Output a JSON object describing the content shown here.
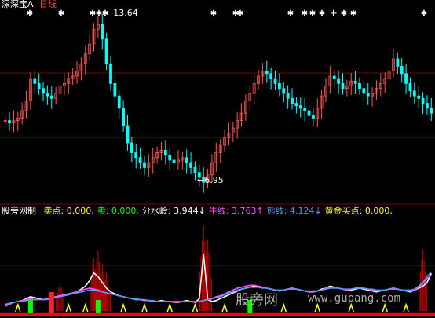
{
  "header": {
    "app_name": "深深宝",
    "symbol": "A",
    "period": "日线"
  },
  "price_panel": {
    "high_label": "13.64",
    "low_label": "6.95",
    "signal_marks": [
      "✱",
      "✱",
      "✱",
      "✱",
      "✱",
      "✱",
      "✱",
      "✱",
      "✱",
      "✱",
      "✱",
      "✱",
      "✚",
      "✱",
      "✱",
      "✱"
    ]
  },
  "indicator_panel": {
    "name": "股旁网制",
    "items": [
      {
        "label": "卖点:",
        "value": "0.000,",
        "color": "#ffff00"
      },
      {
        "label": "卖:",
        "value": "0.000,",
        "color": "#00ff00"
      },
      {
        "label": "分水岭:",
        "value": "3.944",
        "arrow": "↓",
        "color": "#ffffff"
      },
      {
        "label": "牛线:",
        "value": "3.763",
        "arrow": "↑",
        "color": "#ff55ff"
      },
      {
        "label": "熊线:",
        "value": "4.124",
        "arrow": "↓",
        "color": "#5599ff"
      },
      {
        "label": "黄金买点:",
        "value": "0.000,",
        "color": "#ffff00"
      }
    ]
  },
  "watermark": {
    "text": "股旁网",
    "url": "www.gupang.com"
  },
  "colors": {
    "up": "#ff5555",
    "down": "#00ffff",
    "grid": "#7a0000",
    "bar": "#b00000",
    "bull_line": "#ff55ff",
    "bear_line": "#5599ff",
    "divide_line": "#ffffff",
    "buy_mark": "#ffff00",
    "green_bar": "#00ff00"
  },
  "chart_data": [
    {
      "type": "candlestick",
      "title": "深深宝A 日线",
      "ylim": [
        6.5,
        14.0
      ],
      "high_marker": 13.64,
      "low_marker": 6.95,
      "series": [
        {
          "name": "close",
          "values": [
            9.5,
            9.4,
            9.5,
            9.6,
            9.9,
            10.3,
            11.2,
            11.0,
            10.8,
            10.6,
            10.5,
            10.4,
            10.6,
            10.9,
            11.0,
            11.2,
            11.3,
            11.5,
            11.8,
            12.2,
            12.6,
            13.2,
            13.4,
            12.8,
            11.8,
            11.0,
            10.5,
            10.0,
            9.3,
            8.6,
            8.2,
            8.0,
            7.8,
            7.6,
            7.8,
            8.0,
            8.2,
            8.3,
            8.1,
            7.9,
            7.8,
            7.9,
            8.0,
            7.8,
            7.6,
            7.4,
            7.2,
            7.0,
            7.3,
            7.8,
            8.2,
            8.5,
            8.8,
            9.0,
            9.2,
            9.5,
            9.8,
            10.3,
            10.6,
            11.0,
            11.3,
            11.5,
            11.4,
            11.2,
            11.0,
            10.8,
            10.6,
            10.4,
            10.2,
            10.1,
            10.0,
            9.9,
            9.7,
            9.6,
            10.0,
            10.5,
            10.9,
            11.3,
            11.2,
            11.0,
            10.8,
            10.9,
            11.1,
            11.0,
            10.8,
            10.6,
            10.5,
            10.6,
            10.8,
            11.0,
            11.2,
            11.5,
            12.0,
            11.7,
            11.4,
            11.0,
            10.7,
            10.5,
            10.4,
            10.2,
            10.0,
            9.8
          ]
        }
      ]
    },
    {
      "type": "bar",
      "title": "股旁网制",
      "series": [
        {
          "name": "分水岭",
          "values": [
            0.6,
            0.8,
            0.9,
            1.0,
            1.1,
            1.3,
            1.5,
            1.4,
            1.3,
            1.2,
            1.3,
            1.4,
            1.5,
            1.6,
            1.6,
            1.7,
            1.9,
            2.0,
            2.3,
            2.6,
            3.2,
            4.0,
            3.6,
            3.0,
            2.4,
            2.0,
            1.8,
            1.6,
            1.5,
            1.4,
            1.3,
            1.2,
            1.2,
            1.1,
            1.1,
            1.0,
            1.0,
            1.1,
            1.0,
            1.0,
            0.9,
            0.9,
            1.0,
            1.1,
            1.0,
            0.9,
            1.3,
            6.0,
            1.2,
            1.0,
            1.1,
            1.3,
            1.5,
            1.7,
            1.9,
            2.1,
            2.3,
            2.4,
            2.5,
            2.6,
            2.6,
            2.5,
            2.4,
            2.3,
            2.2,
            2.1,
            2.2,
            2.3,
            2.4,
            2.3,
            2.2,
            2.1,
            2.0,
            2.0,
            2.1,
            2.3,
            2.4,
            2.6,
            2.5,
            2.4,
            2.3,
            2.2,
            2.2,
            2.3,
            2.4,
            2.3,
            2.2,
            2.1,
            2.0,
            2.1,
            2.2,
            2.3,
            2.4,
            2.3,
            2.2,
            2.1,
            2.0,
            2.2,
            2.4,
            2.6,
            3.0,
            3.944
          ]
        },
        {
          "name": "牛线",
          "values": [
            0.5,
            0.7,
            0.9,
            1.0,
            1.1,
            1.2,
            1.3,
            1.2,
            1.2,
            1.2,
            1.3,
            1.4,
            1.5,
            1.6,
            1.7,
            1.8,
            1.9,
            2.0,
            2.2,
            2.3,
            2.4,
            2.3,
            2.2,
            2.0,
            1.9,
            1.8,
            1.7,
            1.6,
            1.5,
            1.4,
            1.3,
            1.2,
            1.2,
            1.1,
            1.1,
            1.0,
            1.0,
            1.0,
            1.0,
            1.0,
            0.9,
            0.9,
            1.0,
            1.0,
            1.0,
            0.9,
            1.0,
            1.1,
            1.2,
            1.3,
            1.5,
            1.6,
            1.8,
            2.0,
            2.2,
            2.4,
            2.5,
            2.6,
            2.7,
            2.7,
            2.6,
            2.5,
            2.4,
            2.3,
            2.2,
            2.1,
            2.2,
            2.3,
            2.4,
            2.3,
            2.2,
            2.1,
            2.0,
            2.0,
            2.1,
            2.2,
            2.4,
            2.5,
            2.5,
            2.4,
            2.3,
            2.2,
            2.3,
            2.4,
            2.5,
            2.4,
            2.3,
            2.2,
            2.1,
            2.1,
            2.2,
            2.3,
            2.4,
            2.3,
            2.2,
            2.1,
            2.1,
            2.2,
            2.5,
            2.9,
            3.4,
            3.763
          ]
        },
        {
          "name": "熊线",
          "values": [
            0.7,
            0.8,
            0.9,
            1.0,
            1.0,
            1.1,
            1.2,
            1.2,
            1.2,
            1.2,
            1.2,
            1.3,
            1.4,
            1.5,
            1.6,
            1.7,
            1.8,
            1.9,
            2.0,
            2.1,
            2.2,
            2.2,
            2.1,
            2.0,
            1.9,
            1.8,
            1.7,
            1.6,
            1.5,
            1.4,
            1.3,
            1.3,
            1.2,
            1.2,
            1.1,
            1.1,
            1.0,
            1.0,
            1.0,
            1.0,
            1.0,
            1.0,
            1.0,
            1.0,
            1.0,
            1.0,
            1.0,
            1.1,
            1.2,
            1.3,
            1.4,
            1.5,
            1.7,
            1.9,
            2.0,
            2.2,
            2.3,
            2.4,
            2.5,
            2.5,
            2.5,
            2.4,
            2.4,
            2.3,
            2.2,
            2.2,
            2.2,
            2.3,
            2.3,
            2.3,
            2.2,
            2.1,
            2.1,
            2.1,
            2.1,
            2.2,
            2.3,
            2.4,
            2.4,
            2.4,
            2.3,
            2.3,
            2.3,
            2.4,
            2.4,
            2.4,
            2.3,
            2.3,
            2.2,
            2.2,
            2.2,
            2.3,
            2.3,
            2.3,
            2.2,
            2.2,
            2.2,
            2.3,
            2.6,
            3.0,
            3.6,
            4.124
          ]
        },
        {
          "name": "卖点",
          "values": []
        },
        {
          "name": "卖",
          "values": []
        },
        {
          "name": "黄金买点",
          "values": []
        }
      ],
      "spikes": [
        {
          "index": 13,
          "value": 3.0
        },
        {
          "index": 21,
          "value": 5.5
        },
        {
          "index": 22,
          "value": 6.3
        },
        {
          "index": 23,
          "value": 5.0
        },
        {
          "index": 24,
          "value": 4.0
        },
        {
          "index": 47,
          "value": 9.0
        },
        {
          "index": 48,
          "value": 7.5
        },
        {
          "index": 99,
          "value": 6.5
        }
      ],
      "green_bars": [
        6,
        22,
        58
      ],
      "red_bar": [
        11
      ],
      "buy_marks": [
        3,
        15,
        19,
        28,
        33,
        39,
        45,
        52,
        66,
        74,
        82,
        90,
        95
      ],
      "ylim": [
        0,
        10
      ]
    }
  ]
}
